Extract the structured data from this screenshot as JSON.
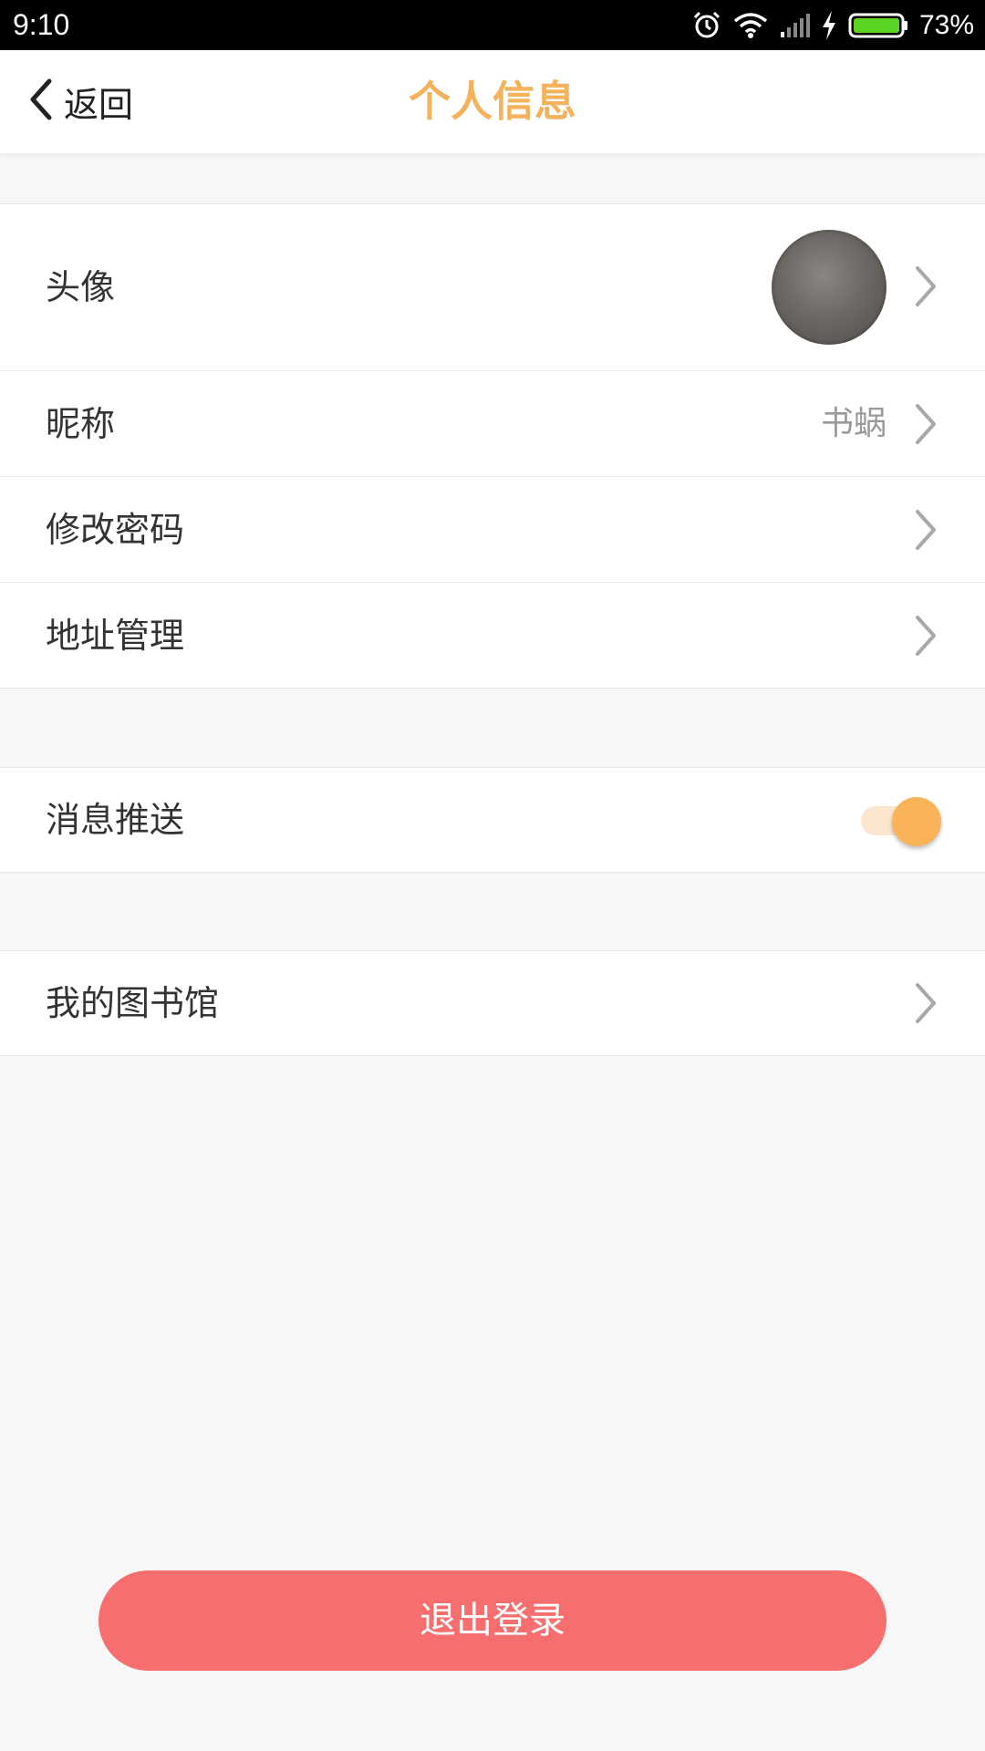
{
  "status_bar": {
    "time": "9:10",
    "battery_percent": "73%",
    "battery_level": 0.73,
    "icons": [
      "alarm-icon",
      "wifi-icon",
      "signal-icon",
      "charging-icon",
      "battery-icon"
    ]
  },
  "navbar": {
    "back_label": "返回",
    "title": "个人信息"
  },
  "settings": {
    "avatar_label": "头像",
    "nickname_label": "昵称",
    "nickname_value": "书蜗",
    "change_password_label": "修改密码",
    "address_label": "地址管理",
    "push_label": "消息推送",
    "push_enabled": true,
    "library_label": "我的图书馆"
  },
  "logout_label": "退出登录",
  "colors": {
    "accent": "#f9b45a",
    "title": "#f5b25c",
    "toggle_track": "#fbe7cf",
    "logout": "#f76e6e",
    "chevron": "#a8a8a8"
  }
}
